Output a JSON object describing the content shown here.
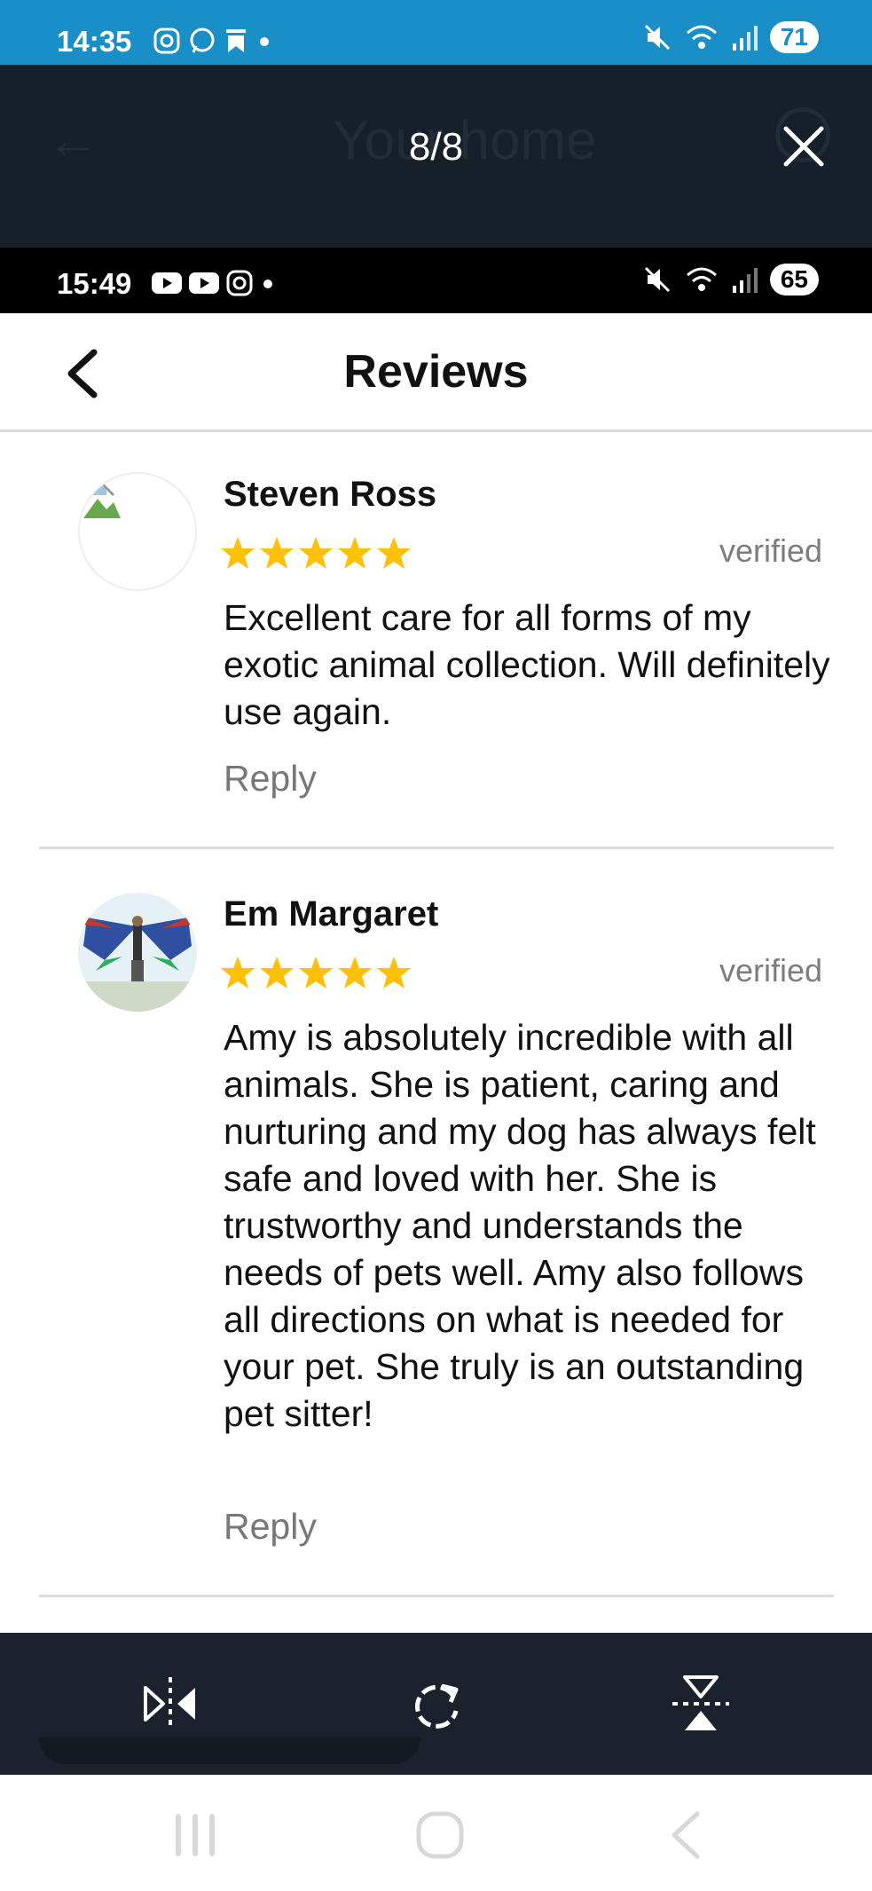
{
  "outer_status": {
    "time": "14:35",
    "battery": "71"
  },
  "viewer": {
    "counter": "8/8",
    "ghost_title": "Your home"
  },
  "inner_status": {
    "time": "15:49",
    "battery": "65"
  },
  "header": {
    "title": "Reviews"
  },
  "reviews": [
    {
      "name": "Steven Ross",
      "rating": 5,
      "badge": "verified",
      "text": "Excellent care for all forms of my exotic animal collection. Will definitely use again.",
      "reply_label": "Reply"
    },
    {
      "name": "Em Margaret",
      "rating": 5,
      "badge": "verified",
      "text": "Amy is absolutely incredible with all animals. She is patient, caring and nurturing and my dog has always felt safe and loved with her. She is trustworthy and understands the needs of pets well. Amy also follows all directions on what is needed for your pet. She truly is an outstanding pet sitter!",
      "reply_label": "Reply"
    }
  ],
  "colors": {
    "star": "#FFC107",
    "status_bar": "#1a8fc7",
    "viewer_bg": "#16202b"
  }
}
